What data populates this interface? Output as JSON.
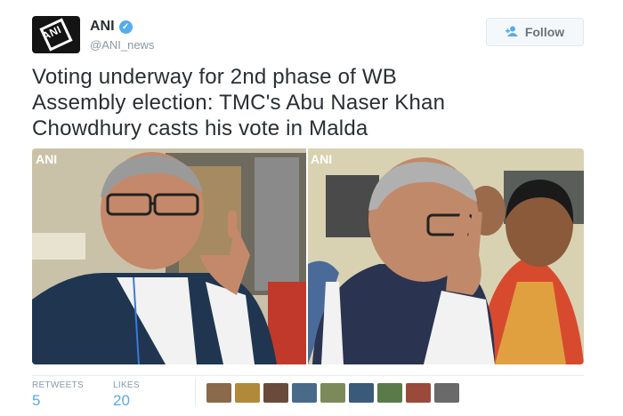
{
  "author": {
    "name": "ANI",
    "handle": "@ANI_news",
    "avatar_logo_text": "ANI",
    "verified_icon": "verified-badge-icon"
  },
  "follow_button": {
    "label": "Follow",
    "icon": "add-user-icon"
  },
  "tweet": {
    "text_line1": "Voting underway for 2nd phase of WB",
    "text_line2": "Assembly election: TMC's Abu Naser Khan",
    "text_line3": "Chowdhury casts his vote in Malda"
  },
  "media": {
    "left_watermark": "ANI",
    "right_watermark": "ANI"
  },
  "stats": {
    "retweets_label": "RETWEETS",
    "retweets_value": "5",
    "likes_label": "LIKES",
    "likes_value": "20"
  },
  "likers": [
    {
      "color": "#8a6a4a"
    },
    {
      "color": "#b08a3a"
    },
    {
      "color": "#6a4a3a"
    },
    {
      "color": "#4a6a8a"
    },
    {
      "color": "#7a8a5a"
    },
    {
      "color": "#3a5a7a"
    },
    {
      "color": "#5a7a4a"
    },
    {
      "color": "#9a4a3a"
    },
    {
      "color": "#6a6a6a"
    }
  ],
  "colors": {
    "accent": "#55acee",
    "text": "#292f33",
    "muted": "#8899a6"
  }
}
